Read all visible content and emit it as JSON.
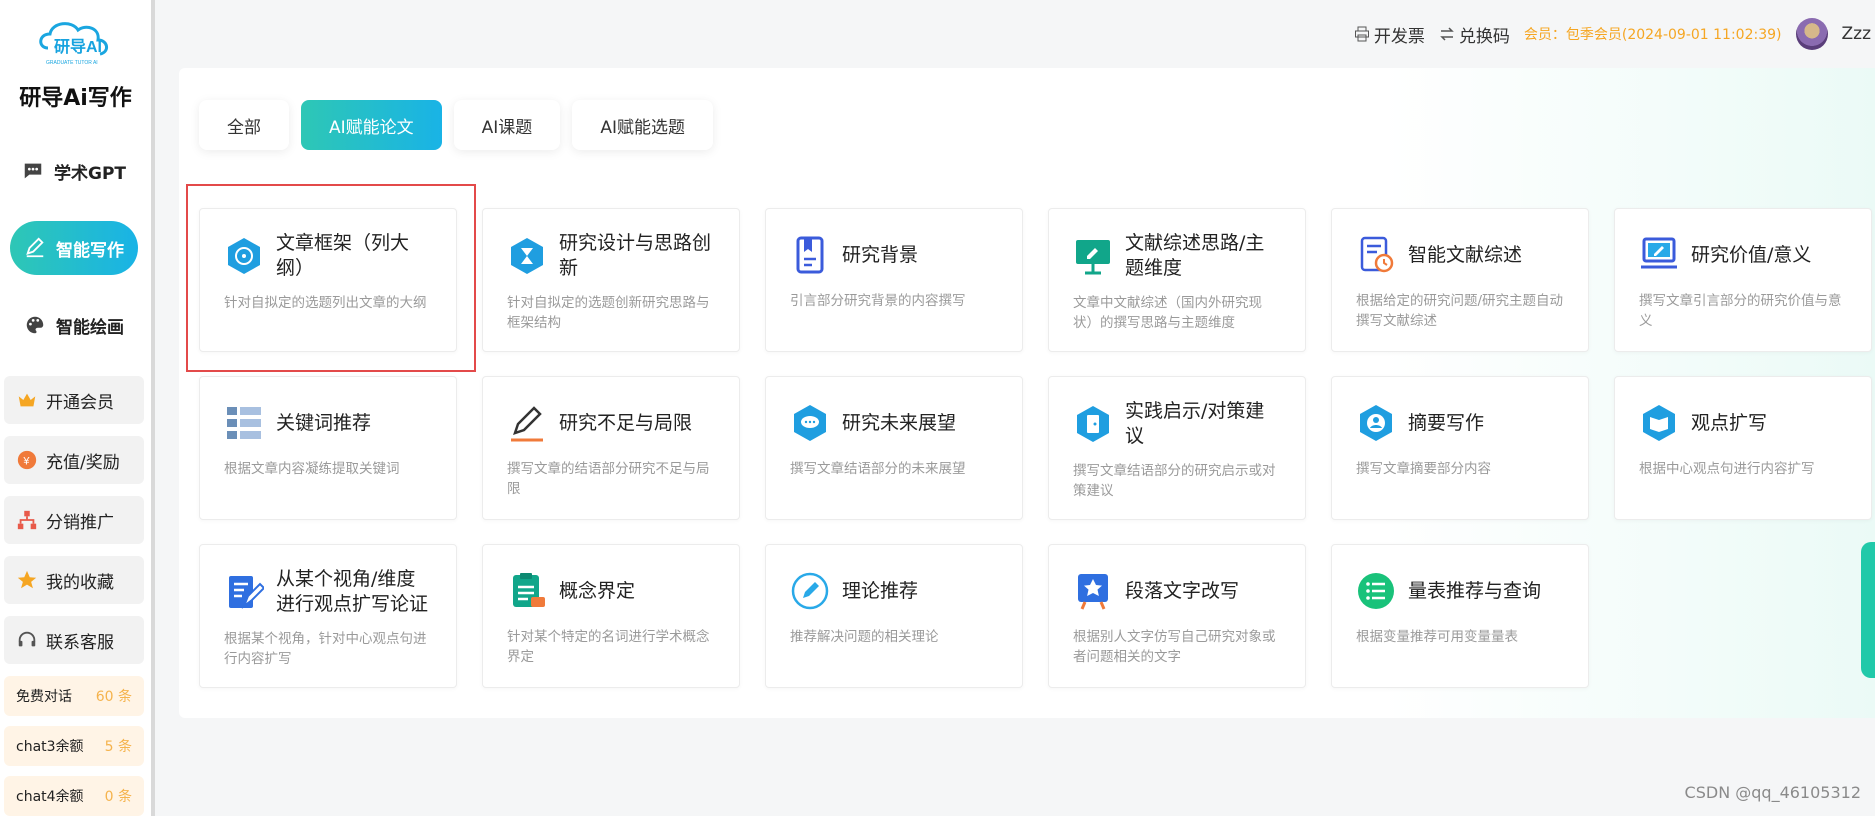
{
  "brand": {
    "name": "研导Ai写作",
    "logo_text": "研导AI",
    "logo_sub": "GRADUATE TUTOR AI"
  },
  "nav": [
    {
      "label": "学术GPT",
      "icon": "chat-bubble-icon",
      "active": false
    },
    {
      "label": "智能写作",
      "icon": "pen-icon",
      "active": true
    },
    {
      "label": "智能绘画",
      "icon": "palette-icon",
      "active": false
    }
  ],
  "side_buttons": [
    {
      "label": "开通会员",
      "icon": "crown-icon"
    },
    {
      "label": "充值/奖励",
      "icon": "coin-icon"
    },
    {
      "label": "分销推广",
      "icon": "network-icon"
    },
    {
      "label": "我的收藏",
      "icon": "star-icon"
    },
    {
      "label": "联系客服",
      "icon": "headset-icon"
    }
  ],
  "quotas": [
    {
      "label": "免费对话",
      "value": "60 条"
    },
    {
      "label": "chat3余额",
      "value": "5 条"
    },
    {
      "label": "chat4余额",
      "value": "0 条"
    }
  ],
  "topbar": {
    "invoice": "开发票",
    "redeem": "兑换码",
    "member": "会员：包季会员(2024-09-01 11:02:39)",
    "username": "Zzz"
  },
  "tabs": [
    {
      "label": "全部",
      "active": false
    },
    {
      "label": "AI赋能论文",
      "active": true
    },
    {
      "label": "AI课题",
      "active": false
    },
    {
      "label": "AI赋能选题",
      "active": false
    }
  ],
  "cards": [
    {
      "title": "文章框架（列大纲）",
      "desc": "针对自拟定的选题列出文章的大纲",
      "icon": "hexagon-outline-icon"
    },
    {
      "title": "研究设计与思路创新",
      "desc": "针对自拟定的选题创新研究思路与框架结构",
      "icon": "hexagon-hourglass-icon"
    },
    {
      "title": "研究背景",
      "desc": "引言部分研究背景的内容撰写",
      "icon": "bookmark-doc-icon"
    },
    {
      "title": "文献综述思路/主题维度",
      "desc": "文章中文献综述（国内外研究现状）的撰写思路与主题维度",
      "icon": "presentation-board-icon"
    },
    {
      "title": "智能文献综述",
      "desc": "根据给定的研究问题/研究主题自动撰写文献综述",
      "icon": "doc-clock-icon"
    },
    {
      "title": "研究价值/意义",
      "desc": "撰写文章引言部分的研究价值与意义",
      "icon": "laptop-pen-icon"
    },
    {
      "title": "关键词推荐",
      "desc": "根据文章内容凝练提取关键词",
      "icon": "list-table-icon"
    },
    {
      "title": "研究不足与局限",
      "desc": "撰写文章的结语部分研究不足与局限",
      "icon": "pencil-icon"
    },
    {
      "title": "研究未来展望",
      "desc": "撰写文章结语部分的未来展望",
      "icon": "hexagon-chat-icon"
    },
    {
      "title": "实践启示/对策建议",
      "desc": "撰写文章结语部分的研究启示或对策建议",
      "icon": "hexagon-door-icon"
    },
    {
      "title": "摘要写作",
      "desc": "撰写文章摘要部分内容",
      "icon": "hexagon-person-icon"
    },
    {
      "title": "观点扩写",
      "desc": "根据中心观点句进行内容扩写",
      "icon": "hexagon-book-icon"
    },
    {
      "title": "从某个视角/维度进行观点扩写论证",
      "desc": "根据某个视角，针对中心观点句进行内容扩写",
      "icon": "doc-edit-icon"
    },
    {
      "title": "概念界定",
      "desc": "针对某个特定的名词进行学术概念界定",
      "icon": "clipboard-icon"
    },
    {
      "title": "理论推荐",
      "desc": "推荐解决问题的相关理论",
      "icon": "circle-pen-icon"
    },
    {
      "title": "段落文字改写",
      "desc": "根据别人文字仿写自己研究对象或者问题相关的文字",
      "icon": "star-board-icon"
    },
    {
      "title": "量表推荐与查询",
      "desc": "根据变量推荐可用变量量表",
      "icon": "list-circle-icon"
    }
  ],
  "watermark": "CSDN @qq_46105312",
  "colors": {
    "accent_from": "#2ec7b5",
    "accent_to": "#19b3e6",
    "highlight": "#e34a4a",
    "member": "#f5a623"
  }
}
